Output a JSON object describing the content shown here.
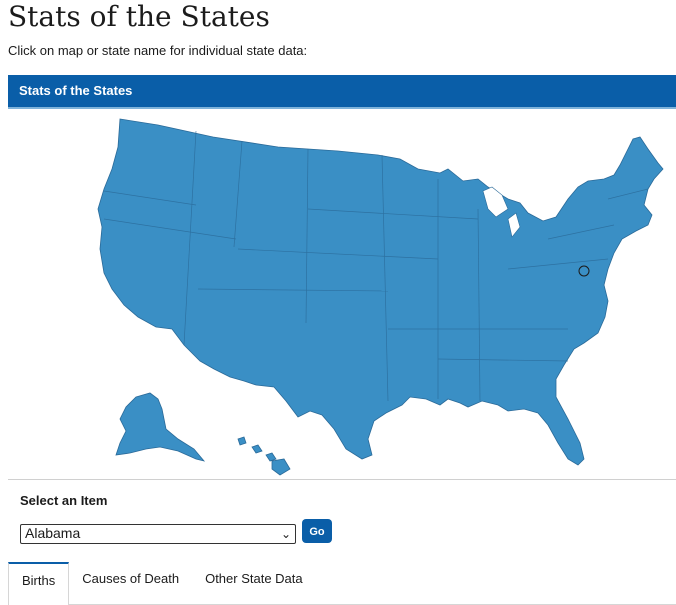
{
  "page": {
    "title": "Stats of the States",
    "intro": "Click on map or state name for individual state data:"
  },
  "map": {
    "header": "Stats of the States",
    "fill_color": "#3a8fc5",
    "stroke_color": "#2a6a99"
  },
  "selector": {
    "label": "Select an Item",
    "selected": "Alabama",
    "go_label": "Go"
  },
  "tabs": [
    {
      "label": "Births",
      "active": true
    },
    {
      "label": "Causes of Death",
      "active": false
    },
    {
      "label": "Other State Data",
      "active": false
    }
  ],
  "colors": {
    "accent": "#0a5ea8",
    "header_underline": "#7fb3da"
  }
}
